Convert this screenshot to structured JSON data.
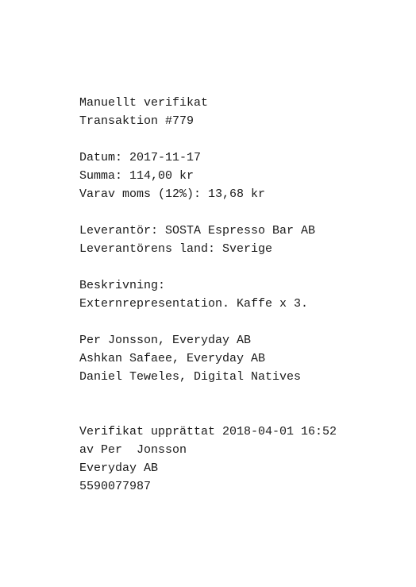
{
  "header": {
    "title": "Manuellt verifikat",
    "transaction": "Transaktion #779"
  },
  "details": {
    "date": "Datum: 2017-11-17",
    "amount": "Summa: 114,00 kr",
    "vat": "Varav moms (12%): 13,68 kr"
  },
  "supplier": {
    "name": "Leverantör: SOSTA Espresso Bar AB",
    "country": "Leverantörens land: Sverige"
  },
  "description": {
    "label": "Beskrivning:",
    "text": "Externrepresentation. Kaffe x 3."
  },
  "participants": [
    "Per Jonsson, Everyday AB",
    "Ashkan Safaee, Everyday AB",
    "Daniel Teweles, Digital Natives"
  ],
  "footer": {
    "created": "Verifikat upprättat 2018-04-01 16:52",
    "by": "av Per  Jonsson",
    "company": "Everyday AB",
    "org_number": "5590077987"
  }
}
